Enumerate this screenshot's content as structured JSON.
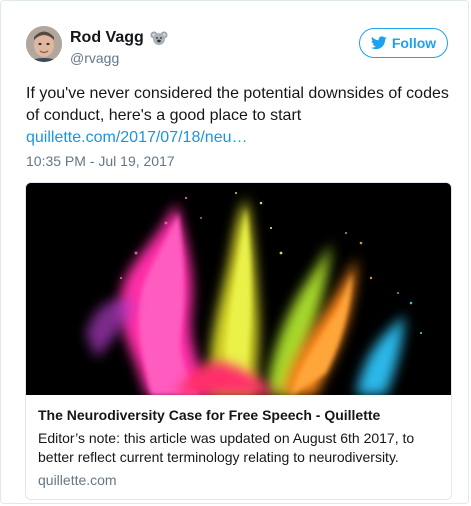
{
  "author": {
    "name": "Rod Vagg",
    "handle": "@rvagg",
    "badge_icon": "koala-icon"
  },
  "follow_button": {
    "label": "Follow",
    "icon": "twitter-bird-icon",
    "color": "#1da1f2"
  },
  "tweet": {
    "text": "If you've never considered the potential downsides of codes of conduct, here's a good place to start",
    "link": "quillette.com/2017/07/18/neu…",
    "timestamp": "10:35 PM - Jul 19, 2017"
  },
  "card": {
    "image_subject": "colorful powder explosion",
    "title": "The Neurodiversity Case for Free Speech - Quillette",
    "description": "Editor’s note: this article was updated on August 6th 2017, to better reflect current terminology relating to neurodiversity.",
    "domain": "quillette.com"
  },
  "colors": {
    "link": "#1b95e0",
    "secondary_text": "#657786",
    "border": "#e1e8ed"
  }
}
